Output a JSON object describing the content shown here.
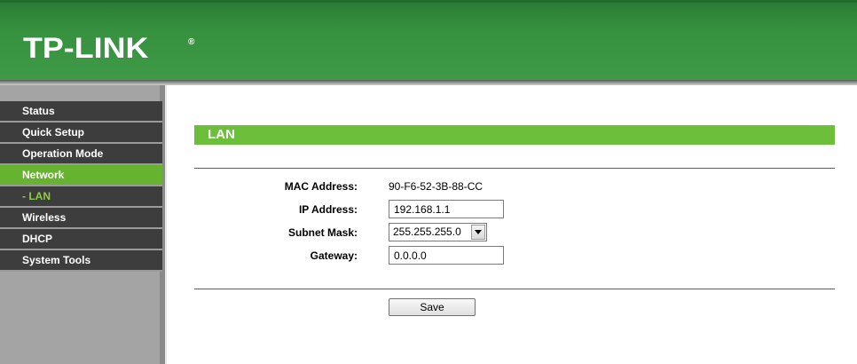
{
  "header": {
    "logo_text": "TP-LINK",
    "logo_mark": "®"
  },
  "sidebar": {
    "items": [
      {
        "label": "Status"
      },
      {
        "label": "Quick Setup"
      },
      {
        "label": "Operation Mode"
      },
      {
        "label": "Network"
      },
      {
        "label": "- LAN"
      },
      {
        "label": "Wireless"
      },
      {
        "label": "DHCP"
      },
      {
        "label": "System Tools"
      }
    ]
  },
  "page": {
    "title": "LAN"
  },
  "form": {
    "mac_label": "MAC Address:",
    "mac_value": "90-F6-52-3B-88-CC",
    "ip_label": "IP Address:",
    "ip_value": "192.168.1.1",
    "subnet_label": "Subnet Mask:",
    "subnet_value": "255.255.255.0",
    "gateway_label": "Gateway:",
    "gateway_value": "0.0.0.0",
    "save_label": "Save"
  },
  "colors": {
    "header_green": "#36913f",
    "menu_dark": "#3d3d3d",
    "menu_active": "#65b32e",
    "submenu_text": "#8ccf3f",
    "title_bar": "#6cbf3a",
    "rule": "#2e7d32"
  },
  "icons": {
    "select_arrow": "chevron-down-icon"
  }
}
